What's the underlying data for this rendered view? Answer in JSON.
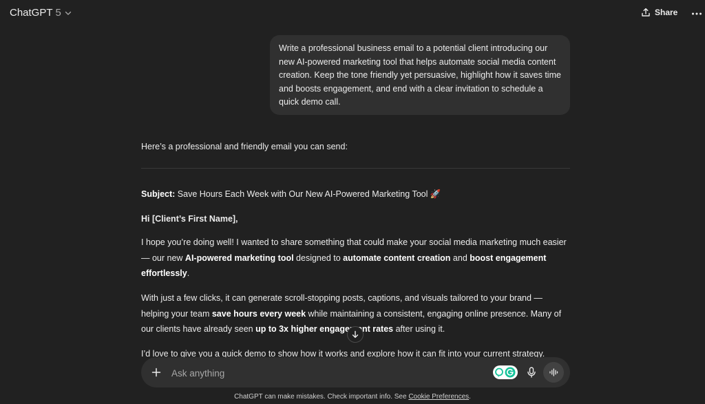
{
  "header": {
    "model_name": "ChatGPT",
    "model_version": "5",
    "share_label": "Share"
  },
  "user_message": "Write a professional business email to a potential client introducing our new AI-powered marketing tool that helps automate social media content creation. Keep the tone friendly yet persuasive, highlight how it saves time and boosts engagement, and end with a clear invitation to schedule a quick demo call.",
  "assistant": {
    "intro": "Here’s a professional and friendly email you can send:",
    "subject_label": "Subject:",
    "subject_text": " Save Hours Each Week with Our New AI-Powered Marketing Tool 🚀",
    "greeting": "Hi [Client’s First Name],",
    "p1": {
      "t1": "I hope you’re doing well! I wanted to share something that could make your social media marketing much easier — our new ",
      "b1": "AI-powered marketing tool",
      "t2": " designed to ",
      "b2": "automate content creation",
      "t3": " and ",
      "b3": "boost engagement effortlessly",
      "t4": "."
    },
    "p2": {
      "t1": "With just a few clicks, it can generate scroll-stopping posts, captions, and visuals tailored to your brand — helping your team ",
      "b1": "save hours every week",
      "t2": " while maintaining a consistent, engaging online presence. Many of our clients have already seen ",
      "b2": "up to 3x higher engagement rates",
      "t3": " after using it."
    },
    "p3": "I’d love to give you a quick demo to show how it works and explore how it can fit into your current strategy."
  },
  "composer": {
    "placeholder": "Ask anything"
  },
  "footer": {
    "text": "ChatGPT can make mistakes. Check important info. See ",
    "link": "Cookie Preferences",
    "end": "."
  },
  "icons": {
    "model_dropdown": "chevron-down-icon",
    "share": "share-icon",
    "more": "more-horizontal-icon",
    "scroll": "arrow-down-icon",
    "plus": "plus-icon",
    "extension": "grammarly-extension-icon",
    "mic": "microphone-icon",
    "voice": "voice-waveform-icon"
  },
  "colors": {
    "background": "#212121",
    "bubble": "#303030",
    "text": "#ececec",
    "grammarly": "#15c39a"
  }
}
